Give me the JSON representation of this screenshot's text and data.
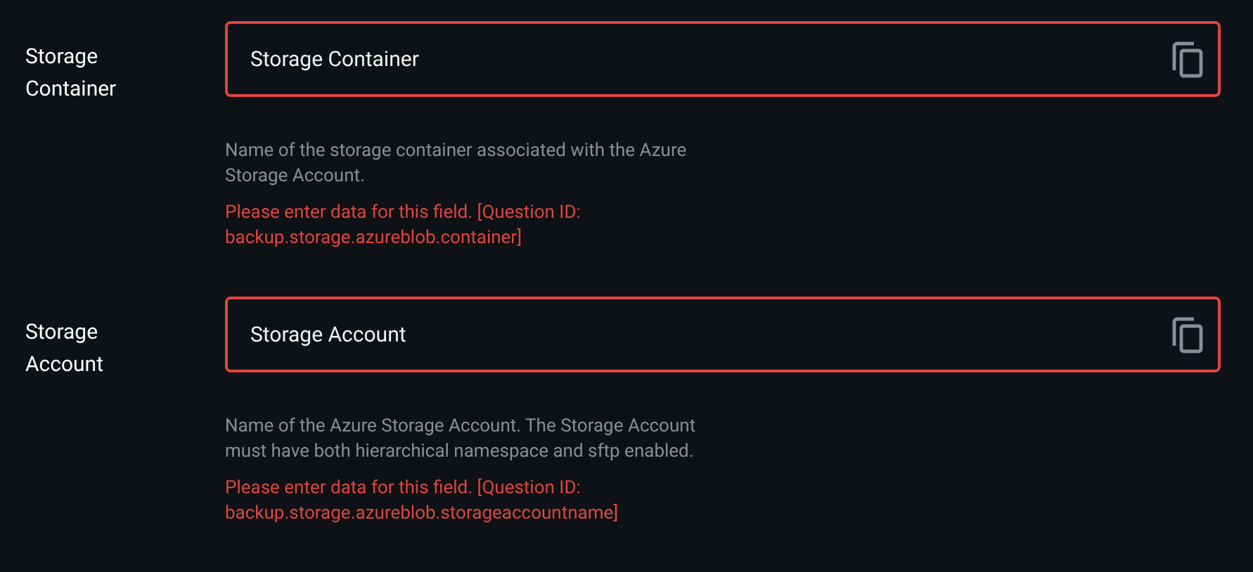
{
  "fields": [
    {
      "label": "Storage Container",
      "placeholder": "Storage Container",
      "invalid": true,
      "help": "Name of the storage container associated with the Azure Storage Account.",
      "error": "Please enter data for this field. [Question ID: backup.storage.azureblob.container]"
    },
    {
      "label": "Storage Account",
      "placeholder": "Storage Account",
      "invalid": true,
      "help": "Name of the Azure Storage Account.  The Storage Account must have both hierarchical namespace and sftp enabled.",
      "error": "Please enter data for this field. [Question ID: backup.storage.azureblob.storageaccountname]"
    }
  ]
}
